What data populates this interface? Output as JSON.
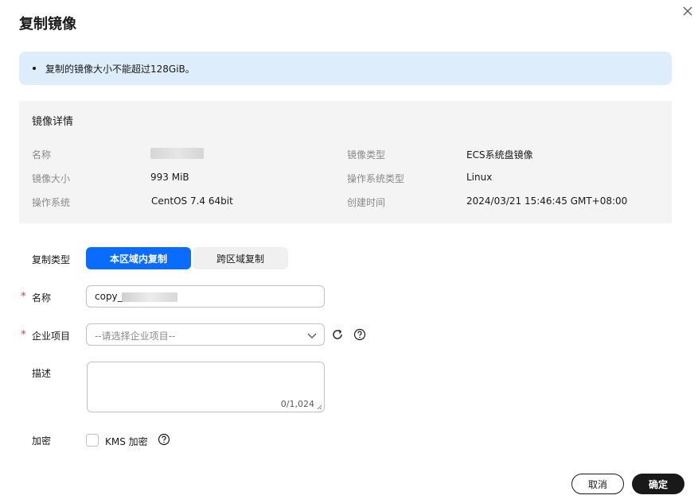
{
  "dialog": {
    "title": "复制镜像",
    "close_icon": "close-icon"
  },
  "banner": {
    "text": "复制的镜像大小不能超过128GiB。",
    "color": "#deedfc"
  },
  "details": {
    "section_title": "镜像详情",
    "rows": [
      {
        "label": "名称",
        "value": ""
      },
      {
        "label": "镜像类型",
        "value": "ECS系统盘镜像"
      },
      {
        "label": "镜像大小",
        "value": "993 MiB"
      },
      {
        "label": "操作系统类型",
        "value": "Linux"
      },
      {
        "label": "操作系统",
        "value": "CentOS 7.4 64bit"
      },
      {
        "label": "创建时间",
        "value": "2024/03/21 15:46:45 GMT+08:00"
      }
    ]
  },
  "form": {
    "copy_type": {
      "label": "复制类型",
      "options": [
        "本区域内复制",
        "跨区域复制"
      ],
      "selected": "本区域内复制"
    },
    "name": {
      "label": "名称",
      "required": "*",
      "value_prefix": "copy_"
    },
    "enterprise_project": {
      "label": "企业项目",
      "required": "*",
      "placeholder": "--请选择企业项目--"
    },
    "description": {
      "label": "描述",
      "counter": "0/1,024"
    },
    "encryption": {
      "label": "加密",
      "checkbox_label": "KMS 加密",
      "checked": false
    }
  },
  "footer": {
    "cancel_label": "取消",
    "ok_label": "确定"
  },
  "colors": {
    "primary": "#0a6cff",
    "required": "#e7332e",
    "dark_button": "#191919"
  }
}
